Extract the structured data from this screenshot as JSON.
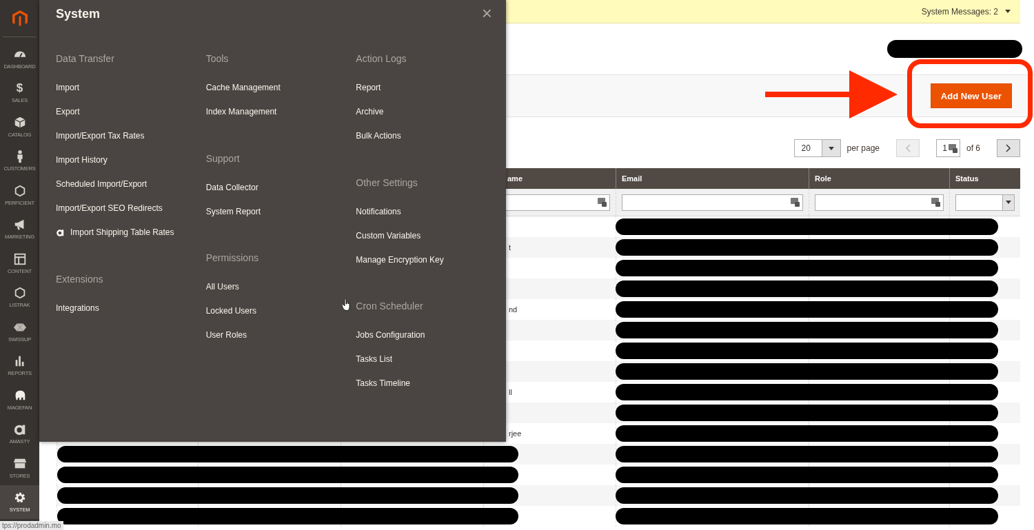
{
  "sidebar": {
    "items": [
      {
        "label": "DASHBOARD",
        "selected": false
      },
      {
        "label": "SALES",
        "glyph": "$",
        "selected": false
      },
      {
        "label": "CATALOG",
        "selected": false
      },
      {
        "label": "CUSTOMERS",
        "selected": false
      },
      {
        "label": "PERFICIENT",
        "selected": false
      },
      {
        "label": "MARKETING",
        "selected": false
      },
      {
        "label": "CONTENT",
        "selected": false
      },
      {
        "label": "LISTRAK",
        "selected": false
      },
      {
        "label": "SWISSUP",
        "selected": false
      },
      {
        "label": "REPORTS",
        "selected": false
      },
      {
        "label": "MAGEFAN",
        "selected": false
      },
      {
        "label": "AMASTY",
        "selected": false
      },
      {
        "label": "STORES",
        "selected": false
      },
      {
        "label": "SYSTEM",
        "selected": true
      }
    ]
  },
  "flyout": {
    "title": "System",
    "close": "×",
    "columns": [
      [
        {
          "heading": "Data Transfer",
          "items": [
            {
              "label": "Import"
            },
            {
              "label": "Export"
            },
            {
              "label": "Import/Export Tax Rates"
            },
            {
              "label": "Import History"
            },
            {
              "label": "Scheduled Import/Export"
            },
            {
              "label": "Import/Export SEO Redirects"
            },
            {
              "label": "Import Shipping Table Rates",
              "has_icon": true
            }
          ]
        },
        {
          "heading": "Extensions",
          "items": [
            {
              "label": "Integrations"
            }
          ]
        }
      ],
      [
        {
          "heading": "Tools",
          "items": [
            {
              "label": "Cache Management"
            },
            {
              "label": "Index Management"
            }
          ]
        },
        {
          "heading": "Support",
          "items": [
            {
              "label": "Data Collector"
            },
            {
              "label": "System Report"
            }
          ]
        },
        {
          "heading": "Permissions",
          "items": [
            {
              "label": "All Users"
            },
            {
              "label": "Locked Users"
            },
            {
              "label": "User Roles"
            }
          ]
        }
      ],
      [
        {
          "heading": "Action Logs",
          "items": [
            {
              "label": "Report"
            },
            {
              "label": "Archive"
            },
            {
              "label": "Bulk Actions"
            }
          ]
        },
        {
          "heading": "Other Settings",
          "items": [
            {
              "label": "Notifications"
            },
            {
              "label": "Custom Variables"
            },
            {
              "label": "Manage Encryption Key"
            }
          ]
        },
        {
          "heading": "Cron Scheduler",
          "items": [
            {
              "label": "Jobs Configuration"
            },
            {
              "label": "Tasks List"
            },
            {
              "label": "Tasks Timeline"
            }
          ]
        }
      ]
    ]
  },
  "message_bar": {
    "text": "System Messages: 2"
  },
  "actions": {
    "add_button": "Add New User"
  },
  "pagination": {
    "per_page_value": "20",
    "per_page_label": "per page",
    "page_value": "1",
    "page_total": "of 6",
    "prev_disabled": true
  },
  "table": {
    "columns": [
      {
        "label": "ame",
        "kind": "text"
      },
      {
        "label": "Email",
        "kind": "text"
      },
      {
        "label": "Role",
        "kind": "text"
      },
      {
        "label": "Status",
        "kind": "select"
      }
    ],
    "rows": [
      {
        "names_redacted": false,
        "email_redacted": true
      },
      {
        "column_4": "t",
        "names_redacted": false,
        "email_redacted": true
      },
      {
        "names_redacted": false,
        "email_redacted": true
      },
      {
        "names_redacted": false,
        "email_redacted": true
      },
      {
        "column_4": "nd",
        "names_redacted": false,
        "email_redacted": true
      },
      {
        "names_redacted": false,
        "email_redacted": true
      },
      {
        "names_redacted": false,
        "email_redacted": true
      },
      {
        "names_redacted": false,
        "email_redacted": true
      },
      {
        "column_4": "ll",
        "names_redacted": false,
        "email_redacted": true
      },
      {
        "names_redacted": false,
        "email_redacted": true
      },
      {
        "column_4": "rjee",
        "names_redacted": false,
        "email_redacted": true
      },
      {
        "names_redacted": true,
        "email_redacted": true
      },
      {
        "names_redacted": true,
        "email_redacted": true
      },
      {
        "names_redacted": true,
        "email_redacted": true
      },
      {
        "names_redacted": true,
        "email_redacted": true
      }
    ]
  },
  "status_url": "tps://prodadmin.mo"
}
